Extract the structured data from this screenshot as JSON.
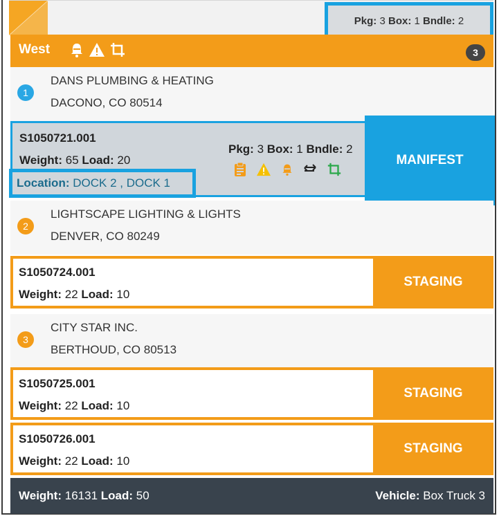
{
  "summary": {
    "pkg_label": "Pkg:",
    "pkg_value": "3",
    "box_label": "Box:",
    "box_value": "1",
    "bndle_label": "Bndle:",
    "bndle_value": "2"
  },
  "route": {
    "name": "West",
    "count": "3"
  },
  "customers": [
    {
      "number": "1",
      "name": "DANS PLUMBING & HEATING",
      "address": "DACONO, CO 80514",
      "color": "#2aa7e4"
    },
    {
      "number": "2",
      "name": "LIGHTSCAPE LIGHTING & LIGHTS",
      "address": "DENVER, CO 80249",
      "color": "#f39c19"
    },
    {
      "number": "3",
      "name": "CITY STAR INC.",
      "address": "BERTHOUD, CO 80513",
      "color": "#f39c19"
    }
  ],
  "selected_shipment": {
    "id": "S1050721.001",
    "weight_label": "Weight:",
    "weight": "65",
    "load_label": "Load:",
    "load": "20",
    "pkg_label": "Pkg:",
    "pkg": "3",
    "box_label": "Box:",
    "box": "1",
    "bndle_label": "Bndle:",
    "bndle": "2",
    "location_label": "Location:",
    "location": "DOCK 2 , DOCK 1",
    "action": "MANIFEST"
  },
  "shipments": [
    {
      "id": "S1050724.001",
      "weight_label": "Weight:",
      "weight": "22",
      "load_label": "Load:",
      "load": "10",
      "action": "STAGING"
    },
    {
      "id": "S1050725.001",
      "weight_label": "Weight:",
      "weight": "22",
      "load_label": "Load:",
      "load": "10",
      "action": "STAGING"
    },
    {
      "id": "S1050726.001",
      "weight_label": "Weight:",
      "weight": "22",
      "load_label": "Load:",
      "load": "10",
      "action": "STAGING"
    }
  ],
  "footer": {
    "weight_label": "Weight:",
    "weight": "16131",
    "load_label": "Load:",
    "load": "50",
    "vehicle_label": "Vehicle:",
    "vehicle": "Box Truck 3"
  },
  "colors": {
    "accent_orange": "#f39c19",
    "accent_blue": "#19a2e0",
    "footer_dark": "#39434d",
    "selected_gray": "#d0d6db"
  },
  "icons": [
    "route-stripe-icon",
    "bell-icon",
    "warning-icon",
    "crop-icon",
    "clipboard-icon",
    "swap-arrows-icon"
  ]
}
